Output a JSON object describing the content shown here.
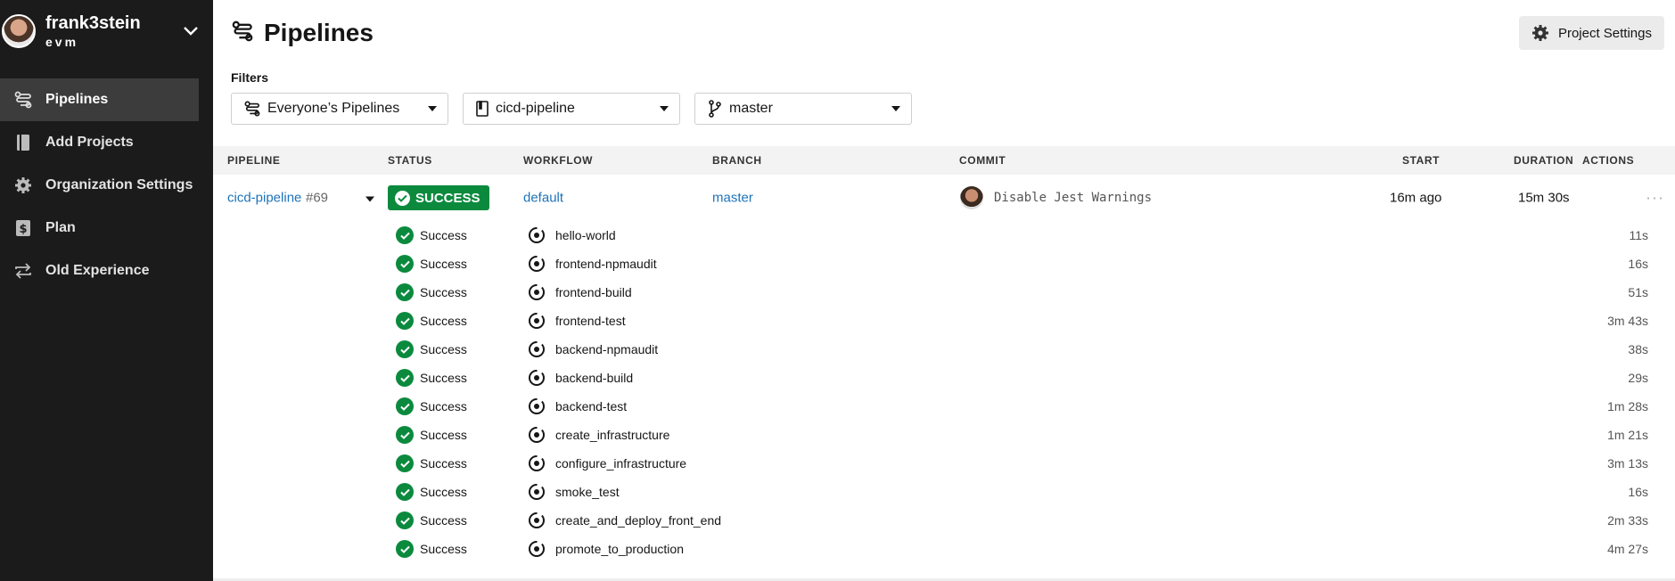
{
  "account": {
    "name": "frank3stein",
    "org": "evm"
  },
  "sidebar": {
    "items": [
      {
        "label": "Pipelines",
        "icon": "pipelines-icon",
        "active": true
      },
      {
        "label": "Add Projects",
        "icon": "book-icon",
        "active": false
      },
      {
        "label": "Organization Settings",
        "icon": "gear-icon",
        "active": false
      },
      {
        "label": "Plan",
        "icon": "dollar-icon",
        "active": false
      },
      {
        "label": "Old Experience",
        "icon": "swap-icon",
        "active": false
      }
    ]
  },
  "header": {
    "title": "Pipelines",
    "settings_label": "Project Settings"
  },
  "filters": {
    "label": "Filters",
    "pipelines": "Everyone’s Pipelines",
    "project": "cicd-pipeline",
    "branch": "master"
  },
  "table": {
    "headers": {
      "pipeline": "PIPELINE",
      "status": "STATUS",
      "workflow": "WORKFLOW",
      "branch": "BRANCH",
      "commit": "COMMIT",
      "start": "START",
      "duration": "DURATION",
      "actions": "ACTIONS"
    },
    "pipeline": {
      "name": "cicd-pipeline",
      "number": "#69",
      "status": "SUCCESS",
      "workflow": "default",
      "branch": "master",
      "commit_message": "Disable Jest Warnings",
      "start": "16m ago",
      "duration": "15m 30s",
      "actions": "···"
    },
    "jobs": [
      {
        "status": "Success",
        "name": "hello-world",
        "duration": "11s"
      },
      {
        "status": "Success",
        "name": "frontend-npmaudit",
        "duration": "16s"
      },
      {
        "status": "Success",
        "name": "frontend-build",
        "duration": "51s"
      },
      {
        "status": "Success",
        "name": "frontend-test",
        "duration": "3m 43s"
      },
      {
        "status": "Success",
        "name": "backend-npmaudit",
        "duration": "38s"
      },
      {
        "status": "Success",
        "name": "backend-build",
        "duration": "29s"
      },
      {
        "status": "Success",
        "name": "backend-test",
        "duration": "1m 28s"
      },
      {
        "status": "Success",
        "name": "create_infrastructure",
        "duration": "1m 21s"
      },
      {
        "status": "Success",
        "name": "configure_infrastructure",
        "duration": "3m 13s"
      },
      {
        "status": "Success",
        "name": "smoke_test",
        "duration": "16s"
      },
      {
        "status": "Success",
        "name": "create_and_deploy_front_end",
        "duration": "2m 33s"
      },
      {
        "status": "Success",
        "name": "promote_to_production",
        "duration": "4m 27s"
      }
    ]
  },
  "colors": {
    "sidebar_bg": "#1b1b1b",
    "success": "#0b8a3e",
    "link": "#1e73b8"
  }
}
